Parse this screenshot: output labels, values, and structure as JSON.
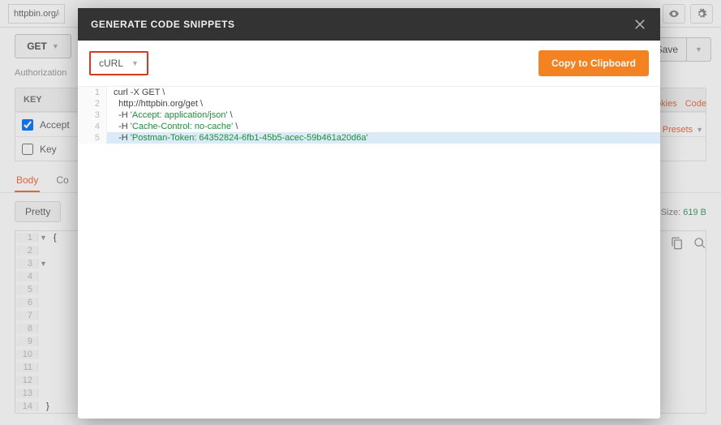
{
  "topbar": {
    "url": "httpbin.org/ge"
  },
  "request": {
    "method": "GET",
    "save_label": "Save",
    "auth_tab": "Authorization",
    "cookies_link": "ookies",
    "code_link": "Code",
    "presets_label": "Presets",
    "key_header": "KEY",
    "rows": [
      {
        "checked": true,
        "key": "Accept"
      },
      {
        "checked": false,
        "key": "Key"
      }
    ]
  },
  "response": {
    "tabs": [
      "Body",
      "Co"
    ],
    "size_label": "Size:",
    "size_value": "619 B",
    "pretty_label": "Pretty",
    "lines": [
      {
        "n": "1",
        "f": "▼",
        "t": "{"
      },
      {
        "n": "2",
        "f": "",
        "t": ""
      },
      {
        "n": "3",
        "f": "▼",
        "t": ""
      },
      {
        "n": "4",
        "f": "",
        "t": ""
      },
      {
        "n": "5",
        "f": "",
        "t": ""
      },
      {
        "n": "6",
        "f": "",
        "t": ""
      },
      {
        "n": "7",
        "f": "",
        "t": ""
      },
      {
        "n": "8",
        "f": "",
        "t": ""
      },
      {
        "n": "9",
        "f": "",
        "t": ""
      },
      {
        "n": "10",
        "f": "",
        "t": ""
      },
      {
        "n": "11",
        "f": "",
        "t": ""
      },
      {
        "n": "12",
        "f": "",
        "t": ""
      },
      {
        "n": "13",
        "f": "",
        "t": ""
      },
      {
        "n": "14",
        "f": "",
        "t": "}"
      }
    ]
  },
  "modal": {
    "title": "GENERATE CODE SNIPPETS",
    "lang": "cURL",
    "copy_label": "Copy to Clipboard",
    "code": [
      {
        "n": 1,
        "sel": false,
        "segs": [
          {
            "c": "tok-plain",
            "t": "curl -X GET \\"
          }
        ]
      },
      {
        "n": 2,
        "sel": false,
        "segs": [
          {
            "c": "tok-plain",
            "t": "  http://httpbin.org/get \\"
          }
        ]
      },
      {
        "n": 3,
        "sel": false,
        "segs": [
          {
            "c": "tok-plain",
            "t": "  -H "
          },
          {
            "c": "tok-str",
            "t": "'Accept: application/json'"
          },
          {
            "c": "tok-plain",
            "t": " \\"
          }
        ]
      },
      {
        "n": 4,
        "sel": false,
        "segs": [
          {
            "c": "tok-plain",
            "t": "  -H "
          },
          {
            "c": "tok-str",
            "t": "'Cache-Control: no-cache'"
          },
          {
            "c": "tok-plain",
            "t": " \\"
          }
        ]
      },
      {
        "n": 5,
        "sel": true,
        "segs": [
          {
            "c": "tok-plain",
            "t": "  -H "
          },
          {
            "c": "tok-str",
            "t": "'Postman-Token: 64352824-6fb1-45b5-acec-59b461a20d6a'"
          }
        ]
      }
    ]
  }
}
